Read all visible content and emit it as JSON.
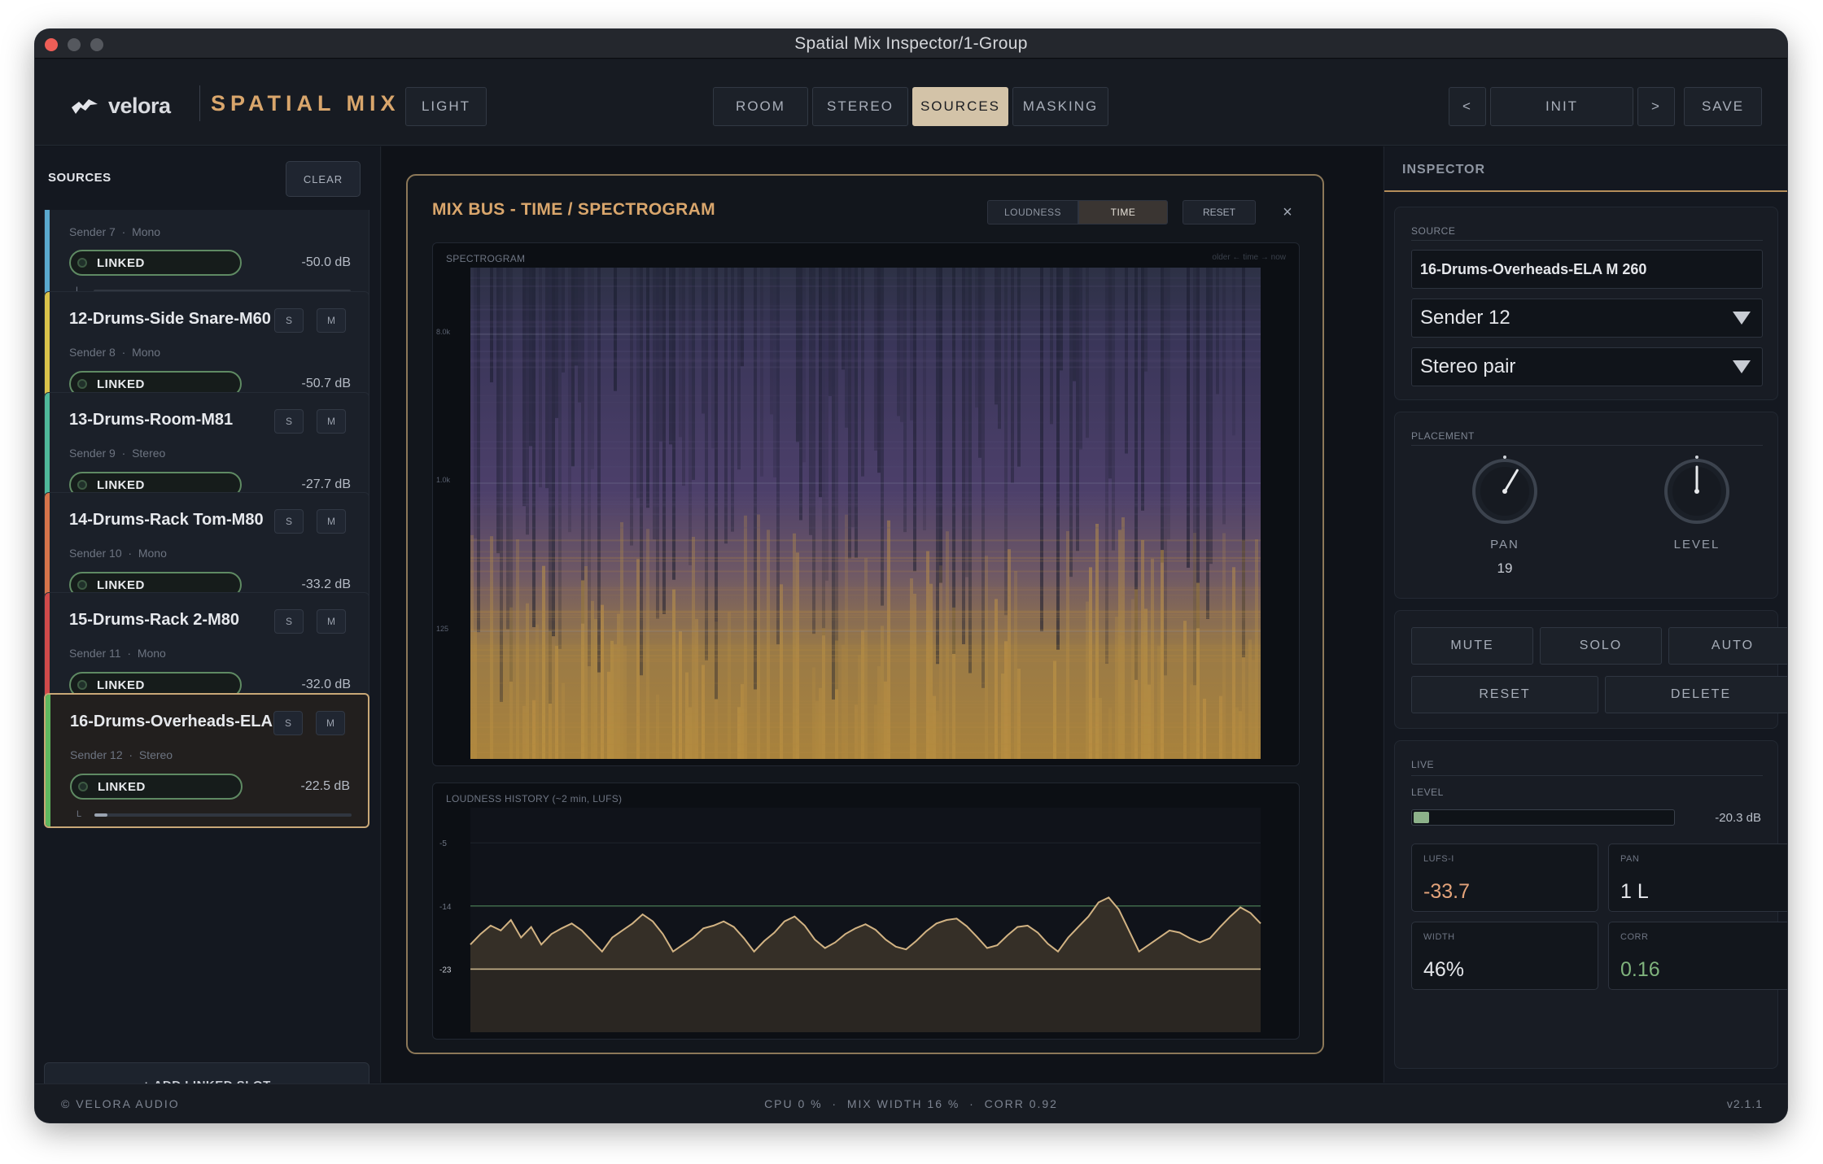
{
  "window": {
    "title": "Spatial Mix Inspector/1-Group"
  },
  "header": {
    "brand": "velora",
    "app_name": "SPATIAL MIX",
    "theme_button": "LIGHT",
    "tabs": [
      {
        "label": "ROOM",
        "active": false
      },
      {
        "label": "STEREO",
        "active": false
      },
      {
        "label": "SOURCES",
        "active": true
      },
      {
        "label": "MASKING",
        "active": false
      }
    ],
    "preset_prev": "<",
    "preset_name": "INIT",
    "preset_next": ">",
    "save_label": "SAVE"
  },
  "sources": {
    "title": "SOURCES",
    "clear_label": "CLEAR",
    "add_label": "+ ADD LINKED SLOT",
    "items": [
      {
        "name": "",
        "sender": "Sender 7",
        "format": "Mono",
        "linked": "LINKED",
        "db": "-50.0 dB",
        "level": 0.0,
        "color": "#5aa9cf",
        "selected": false,
        "partial": true
      },
      {
        "name": "12-Drums-Side Snare-M60",
        "sender": "Sender 8",
        "format": "Mono",
        "linked": "LINKED",
        "db": "-50.7 dB",
        "level": 0.0,
        "color": "#d9c24a",
        "selected": false
      },
      {
        "name": "13-Drums-Room-M81",
        "sender": "Sender 9",
        "format": "Stereo",
        "linked": "LINKED",
        "db": "-27.7 dB",
        "level": 0.04,
        "color": "#4fb89a",
        "selected": false
      },
      {
        "name": "14-Drums-Rack Tom-M80",
        "sender": "Sender 10",
        "format": "Mono",
        "linked": "LINKED",
        "db": "-33.2 dB",
        "level": 0.01,
        "color": "#d6744a",
        "selected": false
      },
      {
        "name": "15-Drums-Rack 2-M80",
        "sender": "Sender 11",
        "format": "Mono",
        "linked": "LINKED",
        "db": "-32.0 dB",
        "level": 0.02,
        "color": "#d04a4a",
        "selected": false
      },
      {
        "name": "16-Drums-Overheads-ELA ...",
        "sender": "Sender 12",
        "format": "Stereo",
        "linked": "LINKED",
        "db": "-22.5 dB",
        "level": 0.05,
        "color": "#5fb85f",
        "selected": true
      }
    ],
    "s_label": "S",
    "m_label": "M",
    "lvl_letter": "L"
  },
  "mixbus": {
    "title": "MIX BUS  -  TIME / SPECTROGRAM",
    "modes": [
      {
        "label": "LOUDNESS",
        "active": false
      },
      {
        "label": "TIME",
        "active": true
      }
    ],
    "reset_label": "RESET",
    "close_glyph": "×",
    "spectrogram_label": "SPECTROGRAM",
    "spectrogram_hint": "older ← time → now",
    "freq_ticks": [
      "8.0k",
      "1.0k",
      "125"
    ],
    "loudness_label": "LOUDNESS HISTORY  (~2 min, LUFS)",
    "loudness_ticks": [
      "-5",
      "-14",
      "-23"
    ]
  },
  "chart_data": {
    "type": "area",
    "title": "LOUDNESS HISTORY  (~2 min, LUFS)",
    "ylabel": "",
    "ylim": [
      -32,
      0
    ],
    "y_ticks": [
      -5,
      -14,
      -23
    ],
    "reference_lines": [
      -14,
      -23
    ],
    "values": [
      -19.5,
      -18,
      -16.8,
      -17.5,
      -16,
      -18.5,
      -17,
      -19.5,
      -18,
      -17.2,
      -16.5,
      -17.5,
      -19,
      -20.5,
      -18.5,
      -17.5,
      -16.5,
      -15.2,
      -16.2,
      -18,
      -20.5,
      -19.5,
      -18.5,
      -17.2,
      -16.8,
      -16.2,
      -17,
      -18.6,
      -20.5,
      -19,
      -17.8,
      -16.2,
      -15.5,
      -16.8,
      -18.8,
      -20,
      -19.2,
      -18,
      -17.2,
      -16.6,
      -17.4,
      -18.8,
      -19.8,
      -20.2,
      -19,
      -17.6,
      -16.5,
      -16,
      -15.8,
      -16.9,
      -18.4,
      -20,
      -19.6,
      -18.2,
      -17,
      -16.8,
      -17.8,
      -19.4,
      -20.5,
      -18.5,
      -17,
      -15.5,
      -13.5,
      -12.8,
      -14.5,
      -17.5,
      -20.5,
      -19.5,
      -18.5,
      -17.5,
      -17.8,
      -18.6,
      -19.2,
      -18.6,
      -17,
      -15.5,
      -14.2,
      -15,
      -16.5
    ]
  },
  "inspector": {
    "title": "INSPECTOR",
    "source_label": "SOURCE",
    "source_name": "16-Drums-Overheads-ELA M 260",
    "sender": "Sender 12",
    "format": "Stereo pair",
    "placement_label": "PLACEMENT",
    "pan_label": "PAN",
    "pan_value": "19",
    "pan_position": 0.19,
    "level_label": "LEVEL",
    "level_position": 0.5,
    "buttons": {
      "mute": "MUTE",
      "solo": "SOLO",
      "auto": "AUTO",
      "reset": "RESET",
      "delete": "DELETE"
    },
    "live_label": "LIVE",
    "live_level_label": "LEVEL",
    "live_level_db": "-20.3 dB",
    "live_level_fraction": 0.06,
    "stats": [
      {
        "label": "LUFS-I",
        "value": "-33.7",
        "color": "#e3a37a"
      },
      {
        "label": "PAN",
        "value": "1 L",
        "color": "#e6e8ec"
      },
      {
        "label": "WIDTH",
        "value": "46%",
        "color": "#e6e8ec"
      },
      {
        "label": "CORR",
        "value": "0.16",
        "color": "#7fb27c"
      }
    ]
  },
  "footer": {
    "copyright": "© VELORA AUDIO",
    "cpu": "CPU 0 %",
    "mix_width": "MIX WIDTH 16 %",
    "corr": "CORR 0.92",
    "version": "v2.1.1"
  }
}
